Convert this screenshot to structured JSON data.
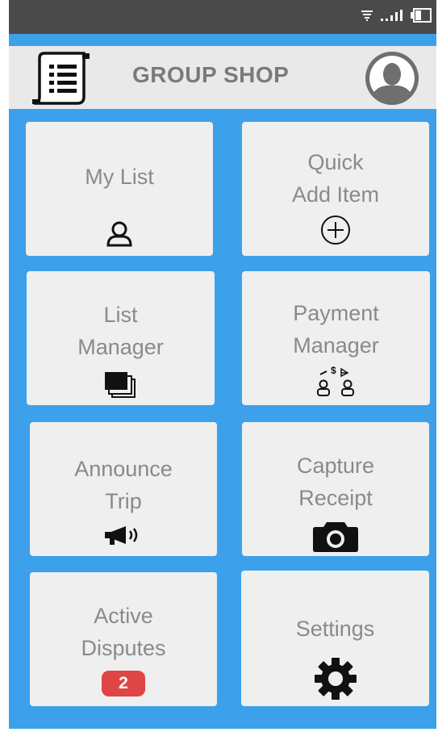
{
  "app": {
    "title": "GROUP SHOP"
  },
  "header": {
    "menu_icon": "list-document-icon",
    "profile_icon": "user-avatar-icon"
  },
  "status_bar": {
    "icons": [
      "wifi-icon",
      "signal-icon",
      "battery-icon"
    ]
  },
  "tiles": [
    {
      "lines": [
        "My List"
      ],
      "icon": "person-icon"
    },
    {
      "lines": [
        "Quick",
        "Add Item"
      ],
      "icon": "plus-circle-icon"
    },
    {
      "lines": [
        "List",
        "Manager"
      ],
      "icon": "stacked-pages-icon"
    },
    {
      "lines": [
        "Payment",
        "Manager"
      ],
      "icon": "payment-exchange-icon"
    },
    {
      "lines": [
        "Announce",
        "Trip"
      ],
      "icon": "megaphone-icon"
    },
    {
      "lines": [
        "Capture",
        "Receipt"
      ],
      "icon": "camera-icon"
    },
    {
      "lines": [
        "Active",
        "Disputes"
      ],
      "icon": "badge",
      "badge": "2"
    },
    {
      "lines": [
        "Settings"
      ],
      "icon": "gear-icon"
    }
  ],
  "colors": {
    "background": "#3da0ea",
    "status_bar": "#4a4a4a",
    "header": "#e9e9e9",
    "tile": "#efefef",
    "text": "#8a8a8a",
    "badge": "#de4545"
  }
}
